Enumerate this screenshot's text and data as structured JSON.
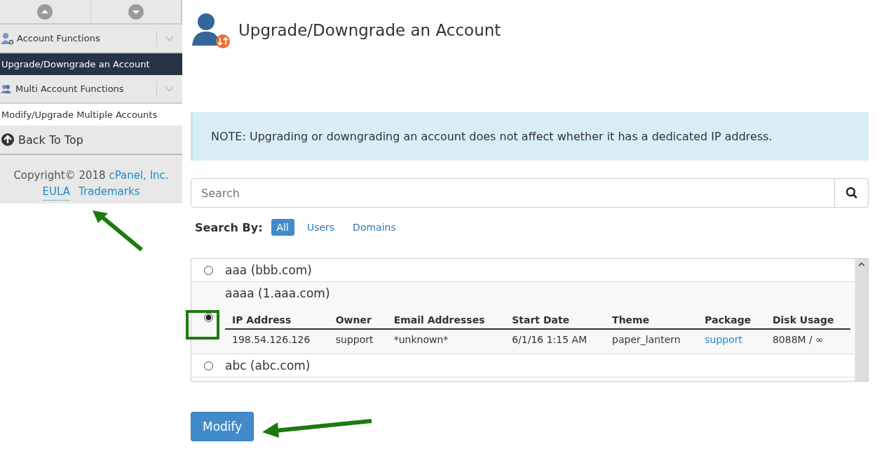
{
  "sidebar": {
    "items": [
      {
        "kind": "category",
        "label": "Account Functions"
      },
      {
        "kind": "link",
        "label": "Upgrade/Downgrade an Account",
        "selected": true
      },
      {
        "kind": "category",
        "label": "Multi Account Functions"
      },
      {
        "kind": "link",
        "label": "Modify/Upgrade Multiple Accounts",
        "selected": false
      },
      {
        "kind": "top",
        "label": "Back To Top"
      }
    ],
    "copyright": "Copyright© 2018",
    "company_link": "cPanel, Inc.",
    "footer_links": [
      "EULA",
      "Trademarks"
    ]
  },
  "page": {
    "title": "Upgrade/Downgrade an Account",
    "note": "NOTE: Upgrading or downgrading an account does not affect whether it has a dedicated IP address.",
    "search": {
      "placeholder": "Search"
    },
    "search_by": {
      "label": "Search By:",
      "options": [
        {
          "label": "All",
          "selected": true
        },
        {
          "label": "Users",
          "selected": false
        },
        {
          "label": "Domains",
          "selected": false
        }
      ]
    },
    "accounts": [
      {
        "label": "aaa (bbb.com)",
        "selected": false
      },
      {
        "label": "aaaa (1.aaa.com)",
        "selected": true,
        "details": {
          "columns": [
            "IP Address",
            "Owner",
            "Email Addresses",
            "Start Date",
            "Theme",
            "Package",
            "Disk Usage"
          ],
          "values": [
            "198.54.126.126",
            "support",
            "*unknown*",
            "6/1/16 1:15 AM",
            "paper_lantern",
            "support",
            "8088M / ∞"
          ]
        }
      },
      {
        "label": "abc (abc.com)",
        "selected": false
      }
    ],
    "button": "Modify"
  }
}
